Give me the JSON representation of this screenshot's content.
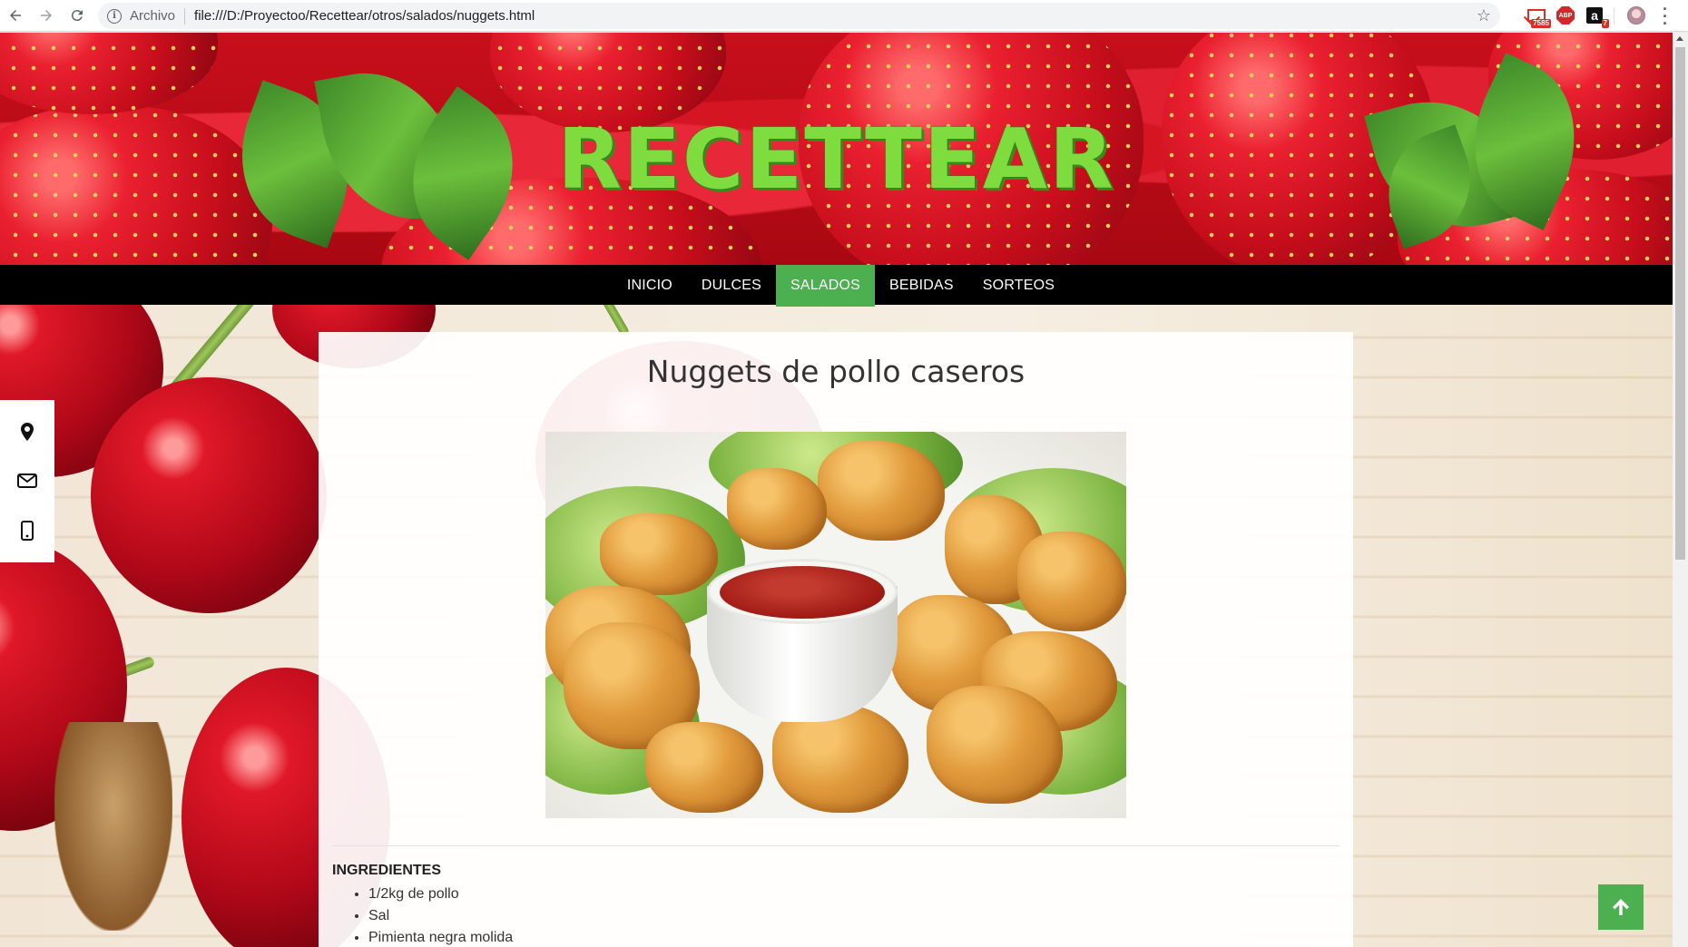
{
  "browser": {
    "scheme_label": "Archivo",
    "url": "file:///D:/Proyectoo/Recettear/otros/salados/nuggets.html",
    "ext_gmail_badge": "7585",
    "ext_abp_label": "ABP",
    "ext_amazon_label": "a",
    "ext_amazon_badge": "7"
  },
  "site": {
    "logo": "RECETTEAR"
  },
  "nav": {
    "items": [
      {
        "label": "INICIO",
        "active": false
      },
      {
        "label": "DULCES",
        "active": false
      },
      {
        "label": "SALADOS",
        "active": true
      },
      {
        "label": "BEBIDAS",
        "active": false
      },
      {
        "label": "SORTEOS",
        "active": false
      }
    ]
  },
  "side_contact": {
    "icons": [
      "map-marker-icon",
      "envelope-icon",
      "mobile-phone-icon"
    ]
  },
  "recipe": {
    "title": "Nuggets de pollo caseros",
    "ingredients_title": "INGREDIENTES",
    "ingredients": [
      "1/2kg de pollo",
      "Sal",
      "Pimienta negra molida"
    ]
  },
  "colors": {
    "nav_bg": "#000000",
    "nav_active": "#4caf50",
    "logo_green": "#7fdc3f",
    "back_to_top": "#4caf50"
  }
}
